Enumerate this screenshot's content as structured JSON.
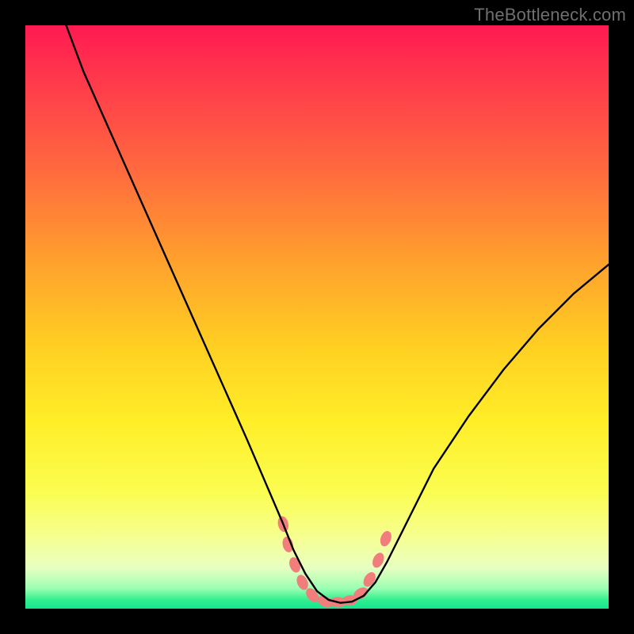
{
  "watermark": "TheBottleneck.com",
  "chart_data": {
    "type": "line",
    "title": "",
    "xlabel": "",
    "ylabel": "",
    "xlim": [
      0,
      100
    ],
    "ylim": [
      0,
      100
    ],
    "grid": false,
    "legend": false,
    "background_gradient": {
      "top": "#ff1a52",
      "mid_high": "#ff9f2d",
      "mid_low": "#ffee28",
      "bottom": "#14e590",
      "note": "vertical gradient, red at top, green at bottom"
    },
    "series": [
      {
        "name": "curve",
        "color": "#000000",
        "x": [
          7,
          10,
          14,
          18,
          22,
          26,
          30,
          34,
          38,
          41,
          44,
          46,
          48,
          50,
          52,
          54,
          56,
          58,
          60,
          62,
          66,
          70,
          76,
          82,
          88,
          94,
          100
        ],
        "y": [
          100,
          92,
          83,
          74,
          65,
          56,
          47,
          38,
          29,
          22,
          15,
          10,
          6,
          3,
          1.5,
          1,
          1.2,
          2.2,
          4.5,
          8,
          16,
          24,
          33,
          41,
          48,
          54,
          59
        ]
      }
    ],
    "markers": {
      "name": "bottom-cluster",
      "color": "#f27d7d",
      "points": [
        {
          "x": 44.2,
          "y": 14.5
        },
        {
          "x": 45.0,
          "y": 11.0
        },
        {
          "x": 46.2,
          "y": 7.5
        },
        {
          "x": 47.5,
          "y": 4.5
        },
        {
          "x": 49.2,
          "y": 2.3
        },
        {
          "x": 51.4,
          "y": 1.2
        },
        {
          "x": 53.6,
          "y": 1.1
        },
        {
          "x": 55.6,
          "y": 1.4
        },
        {
          "x": 57.5,
          "y": 2.6
        },
        {
          "x": 59.0,
          "y": 5.0
        },
        {
          "x": 60.5,
          "y": 8.3
        },
        {
          "x": 61.8,
          "y": 12.0
        }
      ]
    }
  }
}
